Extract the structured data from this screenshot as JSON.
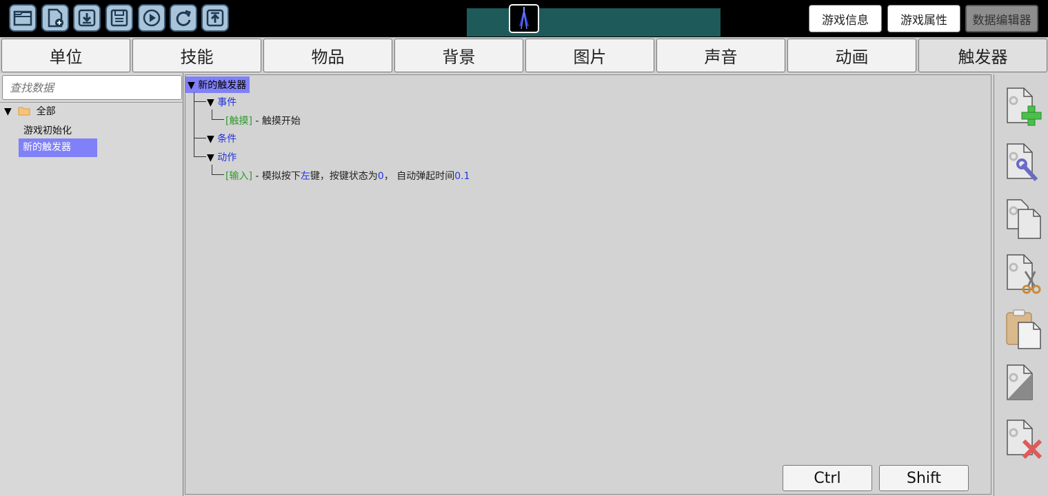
{
  "toolbar": {
    "icons": [
      "open-folder-icon",
      "new-file-icon",
      "download-icon",
      "save-icon",
      "play-icon",
      "refresh-icon",
      "upload-icon"
    ]
  },
  "top_buttons": {
    "game_info": "游戏信息",
    "game_properties": "游戏属性",
    "data_editor": "数据编辑器"
  },
  "tabs": [
    "单位",
    "技能",
    "物品",
    "背景",
    "图片",
    "声音",
    "动画",
    "触发器"
  ],
  "active_tab": "触发器",
  "search": {
    "placeholder": "查找数据",
    "value": ""
  },
  "tree": {
    "root_label": "全部",
    "items": [
      "游戏初始化",
      "新的触发器"
    ],
    "selected": "新的触发器"
  },
  "trigger": {
    "name": "新的触发器",
    "events_label": "事件",
    "event": {
      "category": "[触摸]",
      "sep": " - ",
      "text": "触摸开始"
    },
    "conditions_label": "条件",
    "actions_label": "动作",
    "action": {
      "category": "[输入]",
      "sep": " - ",
      "text1": "模拟按下",
      "key": "左",
      "text2": "键，按键状态为",
      "state": "0",
      "text3": "， 自动弹起时间",
      "time": "0.1"
    }
  },
  "keys": {
    "ctrl": "Ctrl",
    "shift": "Shift"
  },
  "side_tools": [
    "add-trigger-icon",
    "edit-trigger-icon",
    "copy-trigger-icon",
    "cut-trigger-icon",
    "paste-trigger-icon",
    "disable-trigger-icon",
    "delete-trigger-icon"
  ],
  "colors": {
    "selection": "#8080f8",
    "accent_blue": "#2233dd",
    "accent_green": "#2e9a2e",
    "preview_bg": "#1f5a5a"
  }
}
